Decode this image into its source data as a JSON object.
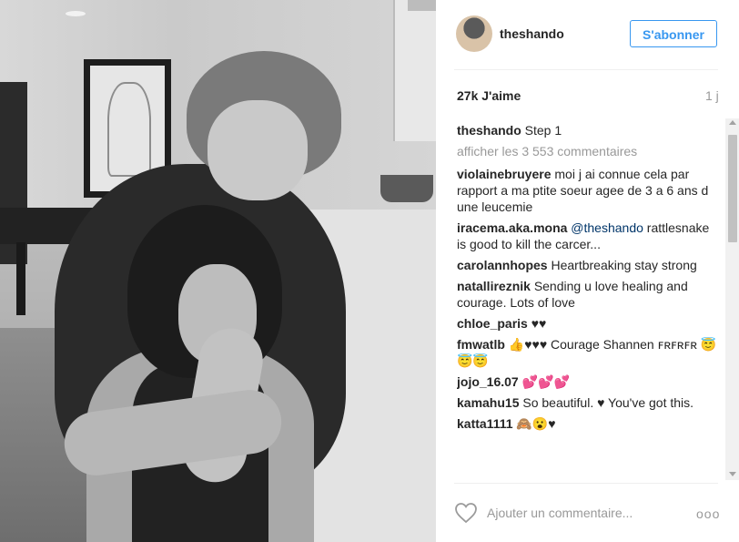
{
  "post": {
    "username": "theshando",
    "follow_label": "S'abonner",
    "likes": "27k J'aime",
    "time_ago": "1 j"
  },
  "caption": {
    "username": "theshando",
    "text": "Step 1"
  },
  "view_all_comments": "afficher les 3 553 commentaires",
  "comments": [
    {
      "user": "violainebruyere",
      "text": "moi j ai connue cela par rapport a ma ptite soeur agee de 3 a 6 ans d une leucemie"
    },
    {
      "user": "iracema.aka.mona",
      "mention": "@theshando",
      "text": "rattlesnake is good to kill the carcer..."
    },
    {
      "user": "carolannhopes",
      "text": "Heartbreaking stay strong"
    },
    {
      "user": "natallireznik",
      "text": "Sending u love healing and courage. Lots of love"
    },
    {
      "user": "chloe_paris",
      "text": "♥♥"
    },
    {
      "user": "fmwatlb",
      "text": "👍♥♥♥ Courage Shannen ꜰʀꜰʀꜰʀ 😇😇😇"
    },
    {
      "user": "jojo_16.07",
      "text": "💕💕💕"
    },
    {
      "user": "kamahu15",
      "text": "So beautiful. ♥ You've got this."
    },
    {
      "user": "katta1111",
      "text": "🙈😮♥"
    }
  ],
  "add_comment_placeholder": "Ajouter un commentaire...",
  "more_options": "ooo",
  "icons": {
    "heart": "heart-outline-icon",
    "more": "more-options-icon"
  },
  "colors": {
    "follow_blue": "#3897f0",
    "muted": "#999999",
    "text": "#262626"
  }
}
